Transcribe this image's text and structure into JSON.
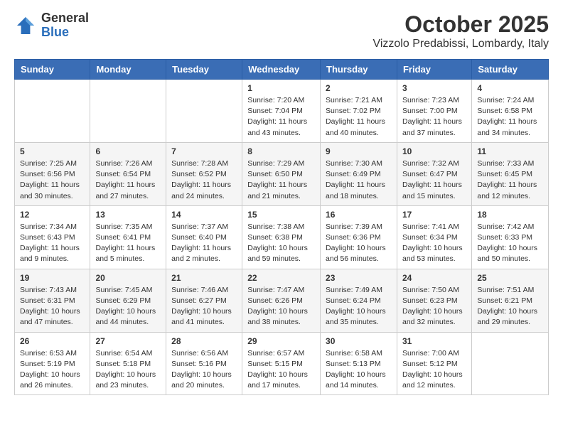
{
  "header": {
    "logo_general": "General",
    "logo_blue": "Blue",
    "month_title": "October 2025",
    "location": "Vizzolo Predabissi, Lombardy, Italy"
  },
  "days_of_week": [
    "Sunday",
    "Monday",
    "Tuesday",
    "Wednesday",
    "Thursday",
    "Friday",
    "Saturday"
  ],
  "weeks": [
    [
      {
        "day": "",
        "info": ""
      },
      {
        "day": "",
        "info": ""
      },
      {
        "day": "",
        "info": ""
      },
      {
        "day": "1",
        "info": "Sunrise: 7:20 AM\nSunset: 7:04 PM\nDaylight: 11 hours and 43 minutes."
      },
      {
        "day": "2",
        "info": "Sunrise: 7:21 AM\nSunset: 7:02 PM\nDaylight: 11 hours and 40 minutes."
      },
      {
        "day": "3",
        "info": "Sunrise: 7:23 AM\nSunset: 7:00 PM\nDaylight: 11 hours and 37 minutes."
      },
      {
        "day": "4",
        "info": "Sunrise: 7:24 AM\nSunset: 6:58 PM\nDaylight: 11 hours and 34 minutes."
      }
    ],
    [
      {
        "day": "5",
        "info": "Sunrise: 7:25 AM\nSunset: 6:56 PM\nDaylight: 11 hours and 30 minutes."
      },
      {
        "day": "6",
        "info": "Sunrise: 7:26 AM\nSunset: 6:54 PM\nDaylight: 11 hours and 27 minutes."
      },
      {
        "day": "7",
        "info": "Sunrise: 7:28 AM\nSunset: 6:52 PM\nDaylight: 11 hours and 24 minutes."
      },
      {
        "day": "8",
        "info": "Sunrise: 7:29 AM\nSunset: 6:50 PM\nDaylight: 11 hours and 21 minutes."
      },
      {
        "day": "9",
        "info": "Sunrise: 7:30 AM\nSunset: 6:49 PM\nDaylight: 11 hours and 18 minutes."
      },
      {
        "day": "10",
        "info": "Sunrise: 7:32 AM\nSunset: 6:47 PM\nDaylight: 11 hours and 15 minutes."
      },
      {
        "day": "11",
        "info": "Sunrise: 7:33 AM\nSunset: 6:45 PM\nDaylight: 11 hours and 12 minutes."
      }
    ],
    [
      {
        "day": "12",
        "info": "Sunrise: 7:34 AM\nSunset: 6:43 PM\nDaylight: 11 hours and 9 minutes."
      },
      {
        "day": "13",
        "info": "Sunrise: 7:35 AM\nSunset: 6:41 PM\nDaylight: 11 hours and 5 minutes."
      },
      {
        "day": "14",
        "info": "Sunrise: 7:37 AM\nSunset: 6:40 PM\nDaylight: 11 hours and 2 minutes."
      },
      {
        "day": "15",
        "info": "Sunrise: 7:38 AM\nSunset: 6:38 PM\nDaylight: 10 hours and 59 minutes."
      },
      {
        "day": "16",
        "info": "Sunrise: 7:39 AM\nSunset: 6:36 PM\nDaylight: 10 hours and 56 minutes."
      },
      {
        "day": "17",
        "info": "Sunrise: 7:41 AM\nSunset: 6:34 PM\nDaylight: 10 hours and 53 minutes."
      },
      {
        "day": "18",
        "info": "Sunrise: 7:42 AM\nSunset: 6:33 PM\nDaylight: 10 hours and 50 minutes."
      }
    ],
    [
      {
        "day": "19",
        "info": "Sunrise: 7:43 AM\nSunset: 6:31 PM\nDaylight: 10 hours and 47 minutes."
      },
      {
        "day": "20",
        "info": "Sunrise: 7:45 AM\nSunset: 6:29 PM\nDaylight: 10 hours and 44 minutes."
      },
      {
        "day": "21",
        "info": "Sunrise: 7:46 AM\nSunset: 6:27 PM\nDaylight: 10 hours and 41 minutes."
      },
      {
        "day": "22",
        "info": "Sunrise: 7:47 AM\nSunset: 6:26 PM\nDaylight: 10 hours and 38 minutes."
      },
      {
        "day": "23",
        "info": "Sunrise: 7:49 AM\nSunset: 6:24 PM\nDaylight: 10 hours and 35 minutes."
      },
      {
        "day": "24",
        "info": "Sunrise: 7:50 AM\nSunset: 6:23 PM\nDaylight: 10 hours and 32 minutes."
      },
      {
        "day": "25",
        "info": "Sunrise: 7:51 AM\nSunset: 6:21 PM\nDaylight: 10 hours and 29 minutes."
      }
    ],
    [
      {
        "day": "26",
        "info": "Sunrise: 6:53 AM\nSunset: 5:19 PM\nDaylight: 10 hours and 26 minutes."
      },
      {
        "day": "27",
        "info": "Sunrise: 6:54 AM\nSunset: 5:18 PM\nDaylight: 10 hours and 23 minutes."
      },
      {
        "day": "28",
        "info": "Sunrise: 6:56 AM\nSunset: 5:16 PM\nDaylight: 10 hours and 20 minutes."
      },
      {
        "day": "29",
        "info": "Sunrise: 6:57 AM\nSunset: 5:15 PM\nDaylight: 10 hours and 17 minutes."
      },
      {
        "day": "30",
        "info": "Sunrise: 6:58 AM\nSunset: 5:13 PM\nDaylight: 10 hours and 14 minutes."
      },
      {
        "day": "31",
        "info": "Sunrise: 7:00 AM\nSunset: 5:12 PM\nDaylight: 10 hours and 12 minutes."
      },
      {
        "day": "",
        "info": ""
      }
    ]
  ]
}
